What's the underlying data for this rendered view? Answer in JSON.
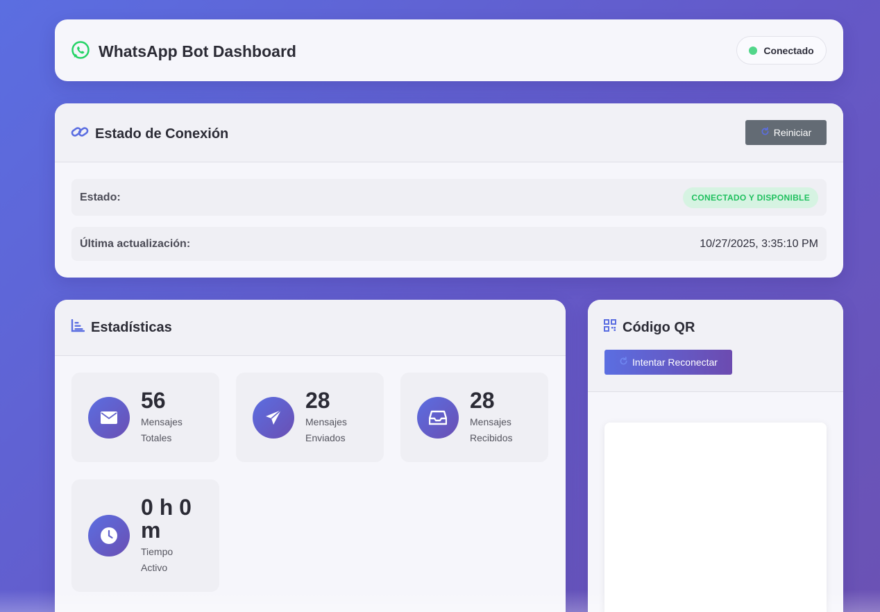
{
  "header": {
    "title": "WhatsApp Bot Dashboard",
    "status_label": "Conectado",
    "status_color": "#52d68a",
    "icon": "whatsapp-icon"
  },
  "connection": {
    "title": "Estado de Conexión",
    "icon": "link-icon",
    "restart_label": "Reiniciar",
    "state_label": "Estado:",
    "state_value": "CONECTADO Y DISPONIBLE",
    "updated_label": "Última actualización:",
    "updated_value": "10/27/2025, 3:35:10 PM"
  },
  "stats": {
    "title": "Estadísticas",
    "icon": "chart-icon",
    "items": [
      {
        "value": "56",
        "label": "Mensajes Totales",
        "icon": "envelope-icon"
      },
      {
        "value": "28",
        "label": "Mensajes Enviados",
        "icon": "paper-plane-icon"
      },
      {
        "value": "28",
        "label": "Mensajes Recibidos",
        "icon": "inbox-icon"
      },
      {
        "value": "0 h 0 m",
        "label": "Tiempo Activo",
        "icon": "clock-icon"
      }
    ]
  },
  "qr": {
    "title": "Código QR",
    "icon": "qrcode-icon",
    "reconnect_label": "Intentar Reconectar"
  },
  "colors": {
    "accent": "#5b6ee1",
    "accent_dark": "#6a4fb3",
    "success": "#1fc05e",
    "restart_button": "#636b74"
  }
}
